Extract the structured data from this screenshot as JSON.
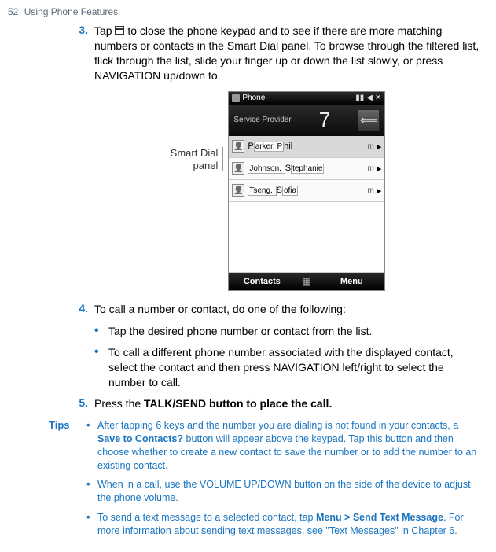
{
  "header": {
    "page_num": "52",
    "section": "Using Phone Features"
  },
  "steps": {
    "s3": {
      "num": "3.",
      "pre": "Tap ",
      "post": " to close the phone keypad and to see if there are more matching numbers or contacts in the Smart Dial panel. To browse through the filtered list, flick through the list, slide your finger up or down the list slowly, or press NAVIGATION up/down to."
    },
    "s4": {
      "num": "4.",
      "text": "To call a number or contact, do one of the following:"
    },
    "s5": {
      "num": "5.",
      "pre": "Press the ",
      "bold": "TALK/SEND button to place the call."
    }
  },
  "s4_bullets": [
    "Tap the desired phone number or contact from the list.",
    "To call a different phone number associated with the displayed contact, select the contact and then press NAVIGATION left/right to select the number to call."
  ],
  "figure": {
    "caption_l1": "Smart Dial",
    "caption_l2": "panel"
  },
  "phone": {
    "status_title": "Phone",
    "provider": "Service Provider",
    "digit": "7",
    "contacts": [
      {
        "pre1": "P",
        "hl1": "arker, P",
        "post1": "hil",
        "type": "m"
      },
      {
        "pre1": "",
        "hl1": "Johnson, ",
        "mid": "S",
        "hl2": "tephanie",
        "type": "m"
      },
      {
        "pre1": "",
        "hl1": "Tseng, ",
        "mid": "S",
        "hl2": "ofia",
        "type": "m"
      }
    ],
    "soft_left": "Contacts",
    "soft_right": "Menu"
  },
  "tips": {
    "label": "Tips",
    "items": [
      {
        "pre": "After tapping 6 keys and the number you are dialing is not found in your contacts, a ",
        "bold": "Save to Contacts?",
        "post": " button will appear above the keypad. Tap this button and then choose whether to create a new contact to save the number or to add the number to an existing contact."
      },
      {
        "pre": "When in a call, use the VOLUME UP/DOWN button on the side of the device to adjust the phone volume."
      },
      {
        "pre": "To send a text message to a selected contact, tap ",
        "bold": "Menu > Send Text Message",
        "post": ". For more information about sending text messages, see \"Text Messages\" in Chapter 6."
      }
    ]
  }
}
